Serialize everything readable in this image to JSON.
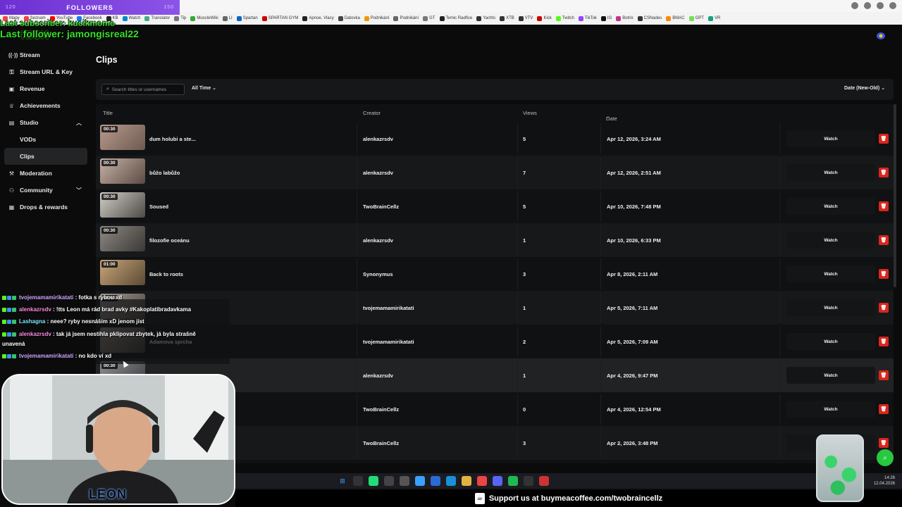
{
  "browser": {
    "bookmarks": [
      "Mapy",
      "Seznam",
      "YouTube",
      "Facebook",
      "KB",
      "Watch",
      "Translator",
      "Tip",
      "MuscleWiki",
      "LI",
      "Spartan",
      "SPARTAN GYM",
      "Apnoe, Vlacy",
      "Datovka",
      "Podnikání",
      "Podnikání",
      "GT",
      "Temic Radfice",
      "Yachts",
      "XTB",
      "VTV",
      "Kick",
      "Twitch",
      "TikTok",
      "IG",
      "Botrix",
      "CSNades",
      "BMAC",
      "GPT",
      "VR"
    ]
  },
  "stream_overlay": {
    "followers_label": "FOLLOWERS",
    "followers_left": "120",
    "followers_right": "150",
    "last_subscriber": "Last subscriber: kucikmomo",
    "last_follower": "Last follower: jamongisreal22",
    "kick_logo": "KICK"
  },
  "sidebar": {
    "items": [
      {
        "label": "Stream",
        "icon": "stream-icon"
      },
      {
        "label": "Stream URL & Key",
        "icon": "key-icon"
      },
      {
        "label": "Revenue",
        "icon": "revenue-icon"
      },
      {
        "label": "Achievements",
        "icon": "trophy-icon"
      },
      {
        "label": "Studio",
        "icon": "studio-icon"
      },
      {
        "label": "VODs",
        "icon": ""
      },
      {
        "label": "Clips",
        "icon": ""
      },
      {
        "label": "Moderation",
        "icon": "moderation-icon"
      },
      {
        "label": "Community",
        "icon": "community-icon"
      },
      {
        "label": "Drops & rewards",
        "icon": "gift-icon"
      }
    ]
  },
  "main": {
    "title": "Clips",
    "search_placeholder": "Search titles or usernames",
    "time_filter": "All Time",
    "sort": "Date (New-Old)",
    "columns": {
      "title": "Title",
      "creator": "Creator",
      "views": "Views",
      "date": "Date"
    },
    "watch_label": "Watch",
    "rows": [
      {
        "duration": "00:30",
        "title": "dum holubi a ste...",
        "creator": "alenkazrsdv",
        "views": "5",
        "date": "Apr 12, 2026, 3:24 AM"
      },
      {
        "duration": "00:30",
        "title": "bůžo labůžo",
        "creator": "alenkazrsdv",
        "views": "7",
        "date": "Apr 12, 2026, 2:51 AM"
      },
      {
        "duration": "00:30",
        "title": "Soused",
        "creator": "TwoBrainCellz",
        "views": "5",
        "date": "Apr 10, 2026, 7:48 PM"
      },
      {
        "duration": "00:30",
        "title": "filozofie oceánu",
        "creator": "alenkazrsdv",
        "views": "1",
        "date": "Apr 10, 2026, 6:33 PM"
      },
      {
        "duration": "01:00",
        "title": "Back to roots",
        "creator": "Synonymus",
        "views": "3",
        "date": "Apr 8, 2026, 2:11 AM"
      },
      {
        "duration": "01:00",
        "title": "",
        "creator": "tvojemamamirikatati",
        "views": "1",
        "date": "Apr 5, 2026, 7:11 AM"
      },
      {
        "duration": "",
        "title": "Adamova sprcha",
        "creator": "tvojemamamirikatati",
        "views": "2",
        "date": "Apr 5, 2026, 7:09 AM"
      },
      {
        "duration": "00:30",
        "title": "",
        "creator": "alenkazrsdv",
        "views": "1",
        "date": "Apr 4, 2026, 9:47 PM"
      },
      {
        "duration": "",
        "title": "",
        "creator": "TwoBrainCellz",
        "views": "0",
        "date": "Apr 4, 2026, 12:54 PM"
      },
      {
        "duration": "",
        "title": "",
        "creator": "TwoBrainCellz",
        "views": "3",
        "date": "Apr 2, 2026, 3:48 PM"
      }
    ]
  },
  "chat": [
    {
      "user": "tvojemamamirikatati",
      "color": "purple",
      "message": ": fotka s rybou xd"
    },
    {
      "user": "alenkazrsdv",
      "color": "pink",
      "message": ": !tts Leon má rád brad avky #Kakoplatibradavkama"
    },
    {
      "user": "Lashagna",
      "color": "cyan",
      "message": ": neee? ryby nesnáším xD jenom jíst"
    },
    {
      "user": "alenkazrsdv",
      "color": "pink",
      "message": ": tak já jsem nestihla pklipovat zbytek, já byla strašně"
    },
    {
      "user": "",
      "color": "pink",
      "message": "unavená"
    },
    {
      "user": "tvojemamamirikatati",
      "color": "purple",
      "message": ": no kdo ví xd"
    }
  ],
  "webcam": {
    "name_tag": "LEON"
  },
  "taskbar": {
    "time": "14:26",
    "date": "12.04.2026"
  },
  "support_banner": "Support us at buymeacoffee.com/twobraincellz",
  "colors": {
    "accent_red": "#d9261c",
    "kick_green": "#53fc18",
    "followers_purple": "#7a3fe0"
  }
}
